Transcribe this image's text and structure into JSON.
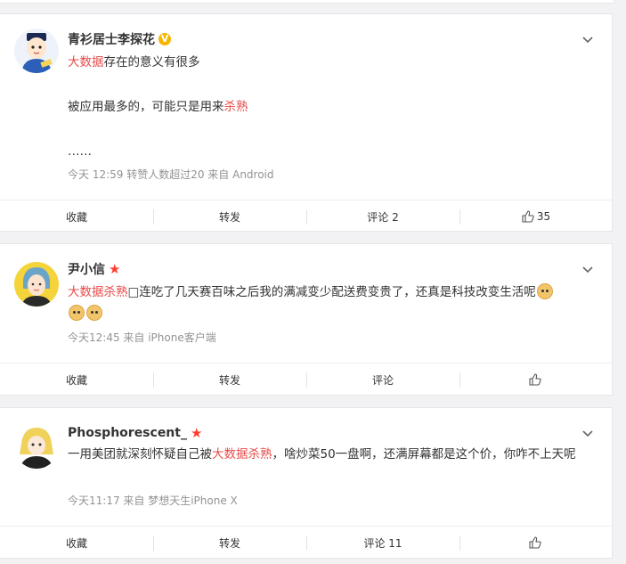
{
  "posts": [
    {
      "author": "青衫居士李探花",
      "badge": "V",
      "para1_hl": "大数据",
      "para1_rest": "存在的意义有很多",
      "para2_pre": "被应用最多的，可能只是用来",
      "para2_hl": "杀熟",
      "para3": "……",
      "meta": "今天 12:59 转赞人数超过20   来自 Android",
      "actions": {
        "fav": "收藏",
        "repost": "转发",
        "comment": "评论 2",
        "like": "35"
      }
    },
    {
      "author": "尹小信",
      "badge": "★",
      "text_hl": "大数据杀熟",
      "text_rest": "□连吃了几天赛百味之后我的满减变少配送费变贵了，还真是科技改变生活呢",
      "meta": "今天12:45  来自 iPhone客户端",
      "actions": {
        "fav": "收藏",
        "repost": "转发",
        "comment": "评论",
        "like": ""
      }
    },
    {
      "author": "Phosphorescent_",
      "badge": "★",
      "text_pre": "一用美团就深刻怀疑自己被",
      "text_hl": "大数据杀熟",
      "text_rest": "，啥炒菜50一盘啊，还满屏幕都是这个价，你咋不上天呢",
      "meta": "今天11:17  来自 梦想天生iPhone X",
      "actions": {
        "fav": "收藏",
        "repost": "转发",
        "comment": "评论 11",
        "like": ""
      }
    }
  ]
}
